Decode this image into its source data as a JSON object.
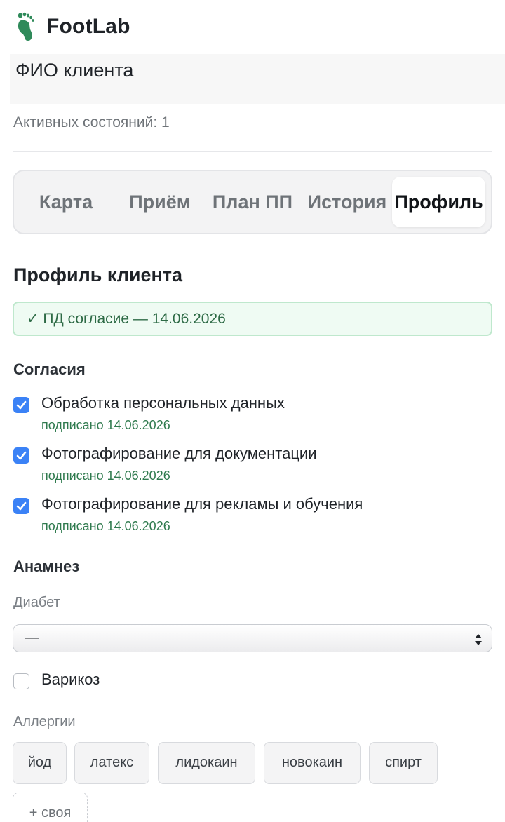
{
  "app": {
    "brand": "FootLab",
    "logo_icon": "footprints-icon",
    "brand_color": "#2f8a5a"
  },
  "client": {
    "name": "ФИО клиента",
    "active_states": "Активных состояний: 1"
  },
  "tabs": [
    {
      "label": "Карта",
      "active": false
    },
    {
      "label": "Приём",
      "active": false
    },
    {
      "label": "План ПП",
      "active": false
    },
    {
      "label": "История",
      "active": false
    },
    {
      "label": "Профиль",
      "active": true
    }
  ],
  "profile": {
    "title": "Профиль клиента",
    "consent_banner": "✓ ПД согласие — 14.06.2026"
  },
  "consents": {
    "heading": "Согласия",
    "items": [
      {
        "label": "Обработка персональных данных",
        "status": "подписано 14.06.2026",
        "checked": true
      },
      {
        "label": "Фотографирование для документации",
        "status": "подписано 14.06.2026",
        "checked": true
      },
      {
        "label": "Фотографирование для рекламы и обучения",
        "status": "подписано 14.06.2026",
        "checked": true
      }
    ]
  },
  "anamnesis": {
    "heading": "Анамнез",
    "diabetes_label": "Диабет",
    "diabetes_value": "—",
    "varicose_label": "Варикоз",
    "varicose_checked": false,
    "allergies_label": "Аллергии",
    "allergy_chips": [
      "йод",
      "латекс",
      "лидокаин",
      "новокаин",
      "спирт"
    ],
    "add_custom": "+ своя"
  },
  "colors": {
    "accent": "#3b82f6",
    "success_text": "#2f7a4e",
    "success_bg": "#effbf3"
  }
}
